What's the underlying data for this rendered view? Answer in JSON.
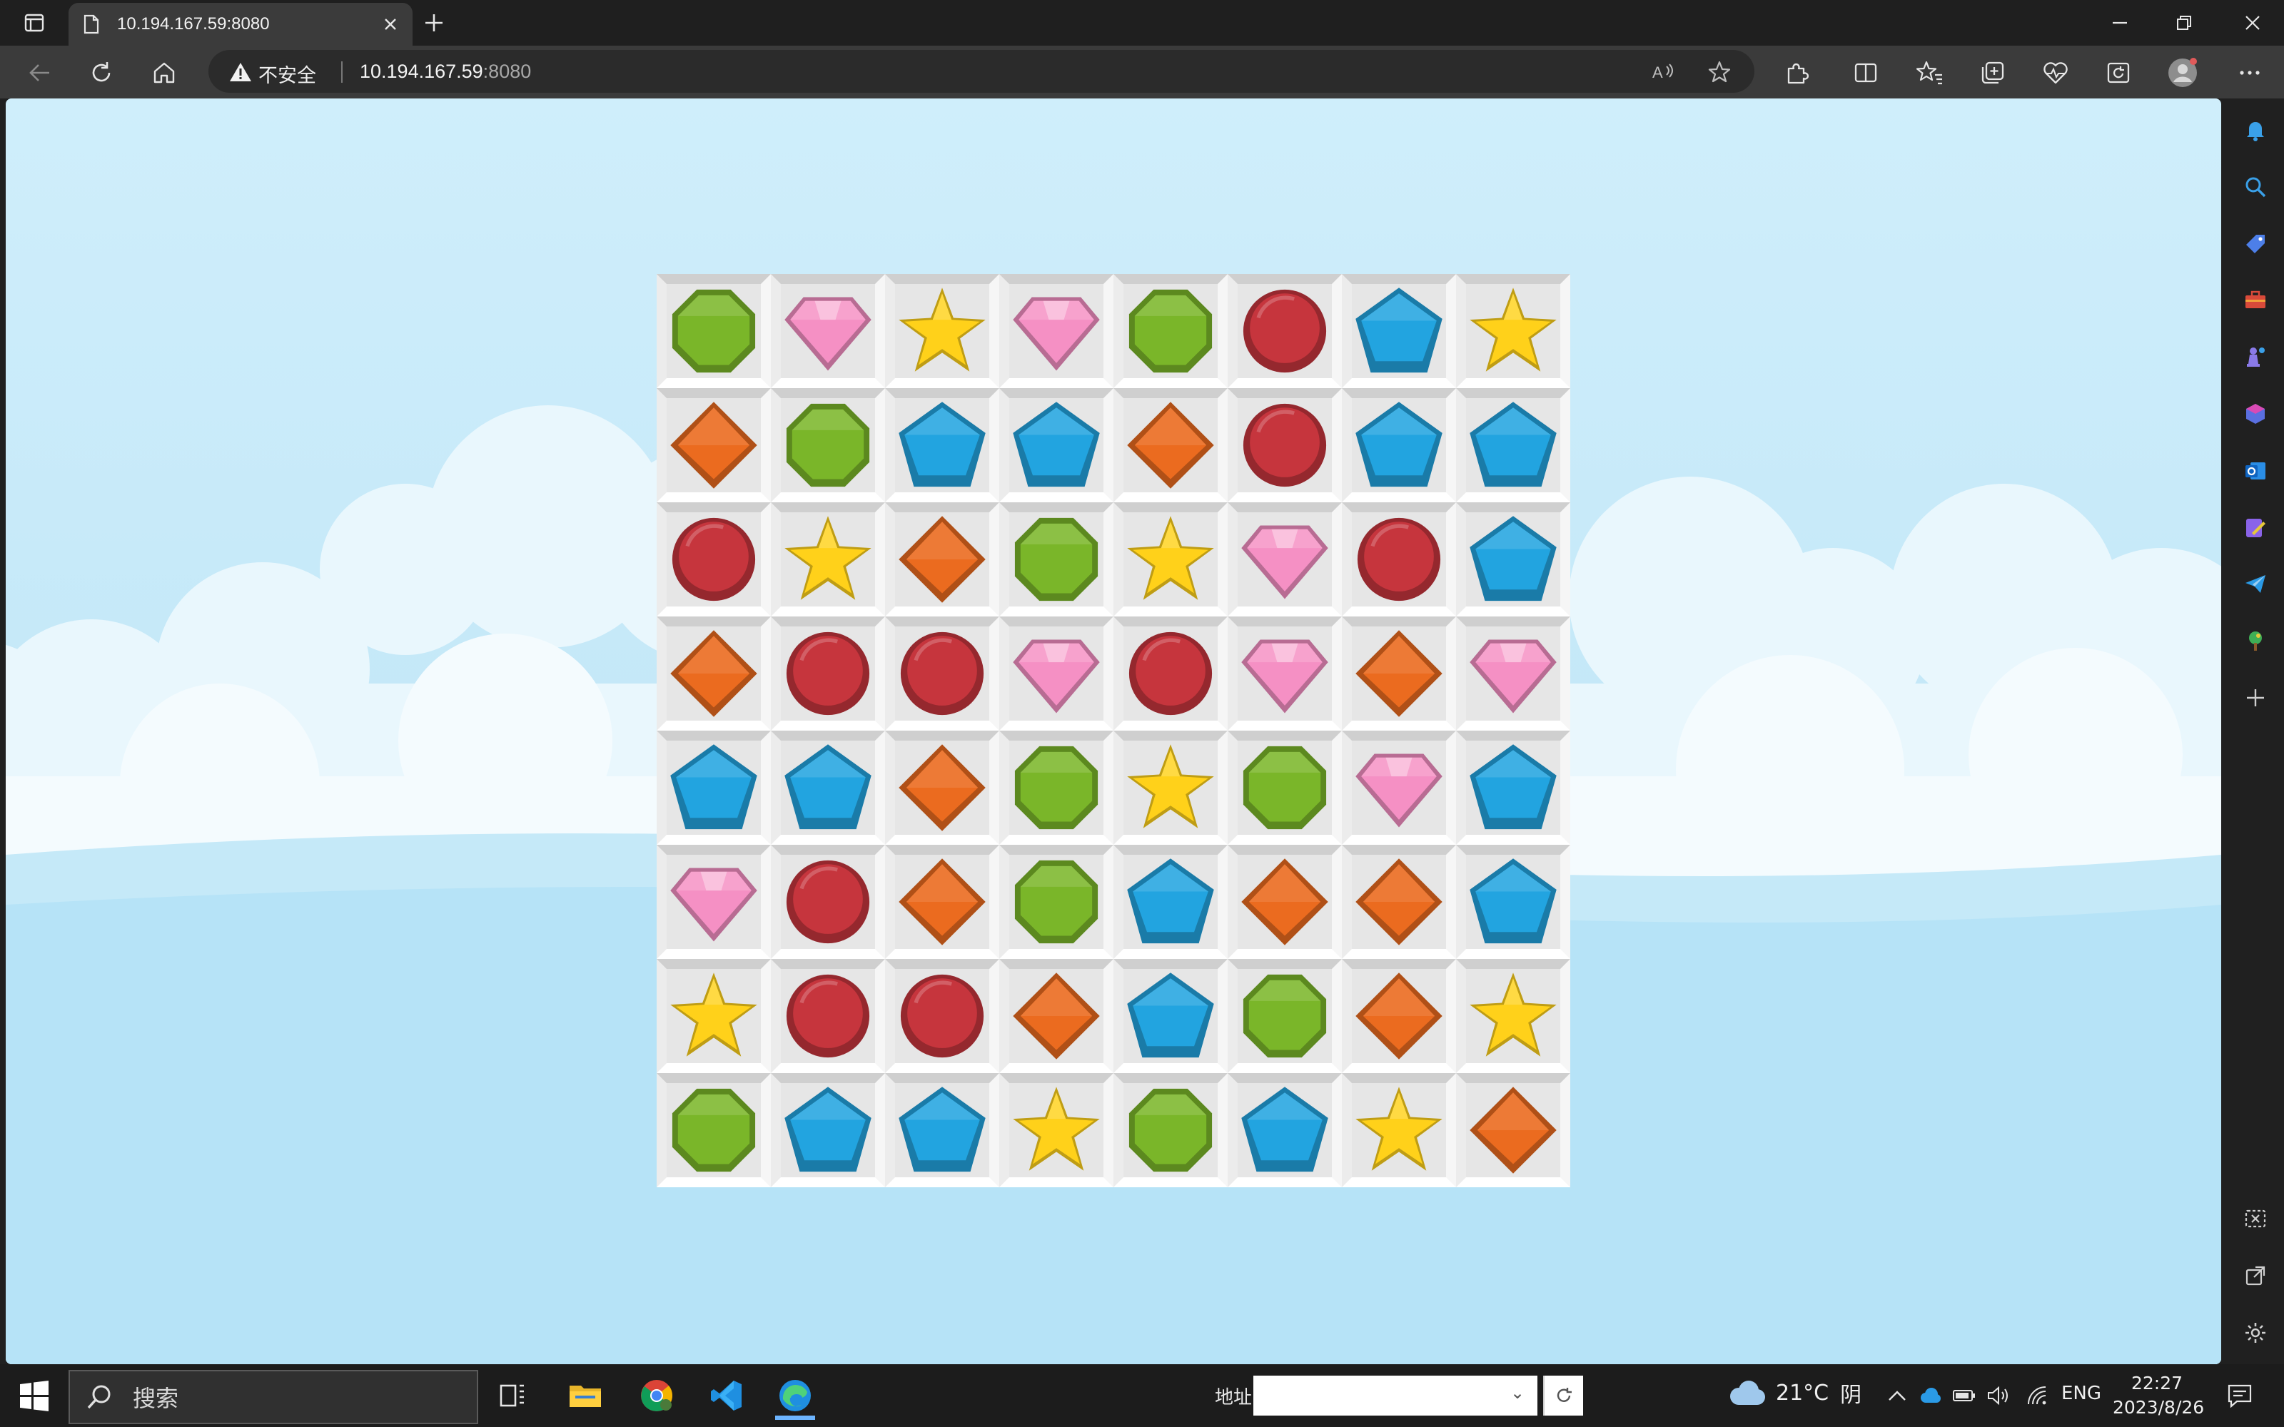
{
  "browser": {
    "tab_title": "10.194.167.59:8080",
    "security_label": "不安全",
    "url_host": "10.194.167.59",
    "url_port": ":8080"
  },
  "board": {
    "rows": [
      [
        "green",
        "pink",
        "yellow",
        "pink",
        "green",
        "red",
        "blue",
        "yellow"
      ],
      [
        "orange",
        "green",
        "blue",
        "blue",
        "orange",
        "red",
        "blue",
        "blue"
      ],
      [
        "red",
        "yellow",
        "orange",
        "green",
        "yellow",
        "pink",
        "red",
        "blue"
      ],
      [
        "orange",
        "red",
        "red",
        "pink",
        "red",
        "pink",
        "orange",
        "pink"
      ],
      [
        "blue",
        "blue",
        "orange",
        "green",
        "yellow",
        "green",
        "pink",
        "blue"
      ],
      [
        "pink",
        "red",
        "orange",
        "green",
        "blue",
        "orange",
        "orange",
        "blue"
      ],
      [
        "yellow",
        "red",
        "red",
        "orange",
        "blue",
        "green",
        "orange",
        "yellow"
      ],
      [
        "green",
        "blue",
        "blue",
        "yellow",
        "green",
        "blue",
        "yellow",
        "orange"
      ]
    ],
    "gem_shapes": {
      "green": "octagon",
      "pink": "diamond-cut",
      "yellow": "star",
      "red": "circle",
      "blue": "pentagon",
      "orange": "rhombus"
    },
    "gem_colors": {
      "green": "#7ab629",
      "pink": "#f590c4",
      "yellow": "#ffd11a",
      "red": "#c6353d",
      "blue": "#22a4e0",
      "orange": "#eb6b1f"
    }
  },
  "taskbar": {
    "search_placeholder": "搜索",
    "address_label": "地址",
    "weather_temp": "21°C",
    "weather_condition": "阴",
    "language": "ENG",
    "time": "22:27",
    "date": "2023/8/26"
  }
}
